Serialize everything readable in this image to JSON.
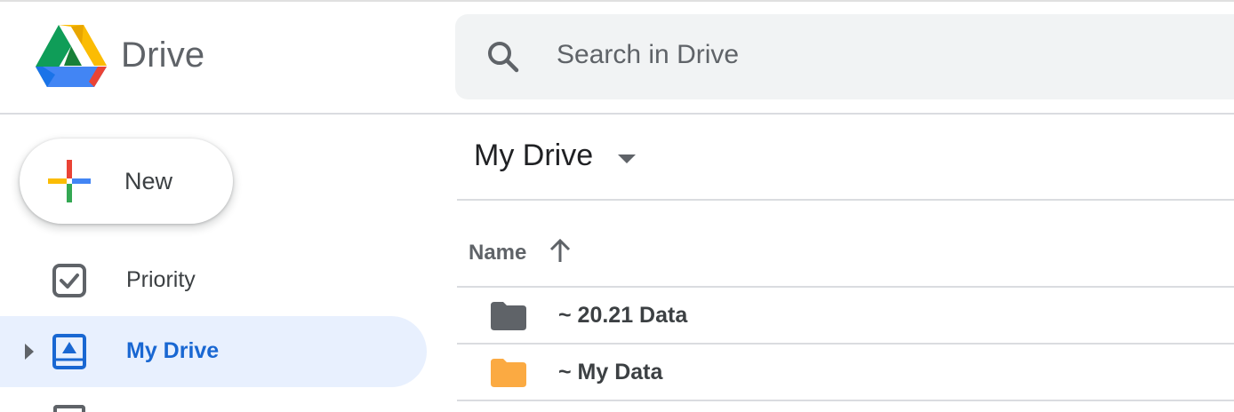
{
  "app": {
    "brand_name": "Drive"
  },
  "search": {
    "placeholder": "Search in Drive"
  },
  "sidebar": {
    "new_label": "New",
    "items": [
      {
        "label": "Priority",
        "icon": "priority-check-icon",
        "active": false
      },
      {
        "label": "My Drive",
        "icon": "my-drive-icon",
        "active": true
      }
    ]
  },
  "main": {
    "title": "My Drive",
    "columns": {
      "name": "Name",
      "sort": "ascending"
    },
    "files": [
      {
        "name": "~ 20.21 Data",
        "type": "folder",
        "color": "#5f6368"
      },
      {
        "name": "~ My Data",
        "type": "folder",
        "color": "#fbaa42"
      }
    ]
  },
  "colors": {
    "accent": "#1967d2",
    "active_bg": "#e8f0fe",
    "search_bg": "#f1f3f4"
  }
}
